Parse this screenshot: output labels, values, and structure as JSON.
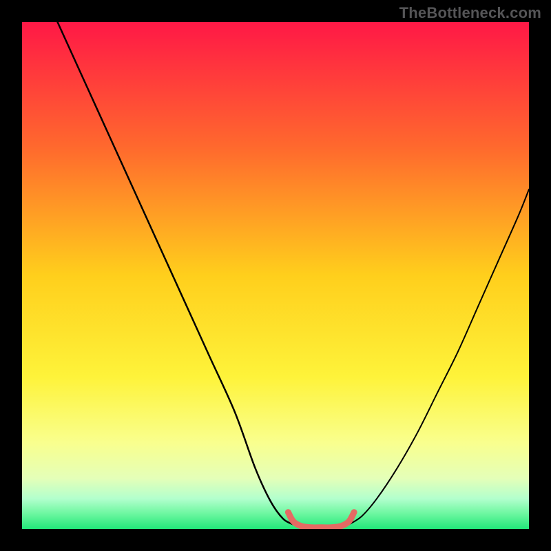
{
  "watermark": "TheBottleneck.com",
  "chart_data": {
    "type": "line",
    "title": "",
    "xlabel": "",
    "ylabel": "",
    "xlim": [
      0,
      100
    ],
    "ylim": [
      0,
      100
    ],
    "grid": false,
    "legend": false,
    "background_gradient_stops": [
      {
        "offset": 0.0,
        "color": "#ff1846"
      },
      {
        "offset": 0.25,
        "color": "#ff6a2d"
      },
      {
        "offset": 0.5,
        "color": "#ffcf1c"
      },
      {
        "offset": 0.7,
        "color": "#fef33a"
      },
      {
        "offset": 0.83,
        "color": "#f9ff8e"
      },
      {
        "offset": 0.9,
        "color": "#e4ffb8"
      },
      {
        "offset": 0.94,
        "color": "#b3ffcd"
      },
      {
        "offset": 0.97,
        "color": "#6cf7a0"
      },
      {
        "offset": 1.0,
        "color": "#22e87a"
      }
    ],
    "series": [
      {
        "name": "left-curve",
        "color": "#000000",
        "width": 2.5,
        "x": [
          7,
          12,
          17,
          22,
          27,
          32,
          37,
          42,
          46,
          49,
          51.5,
          53.5
        ],
        "y": [
          100,
          89,
          78,
          67,
          56,
          45,
          34,
          23,
          12,
          5.5,
          2.0,
          0.9
        ]
      },
      {
        "name": "right-curve",
        "color": "#000000",
        "width": 2.0,
        "x": [
          64.5,
          67,
          70,
          74,
          78,
          82,
          86,
          90,
          94,
          98,
          100
        ],
        "y": [
          0.9,
          2.5,
          6,
          12,
          19,
          27,
          35,
          44,
          53,
          62,
          67
        ]
      },
      {
        "name": "bottom-arc",
        "color": "#e56a63",
        "width": 9,
        "x": [
          52.5,
          53.5,
          55,
          57,
          59,
          61,
          63,
          64.5,
          65.5
        ],
        "y": [
          3.3,
          1.5,
          0.6,
          0.3,
          0.3,
          0.3,
          0.6,
          1.5,
          3.3
        ]
      }
    ]
  }
}
